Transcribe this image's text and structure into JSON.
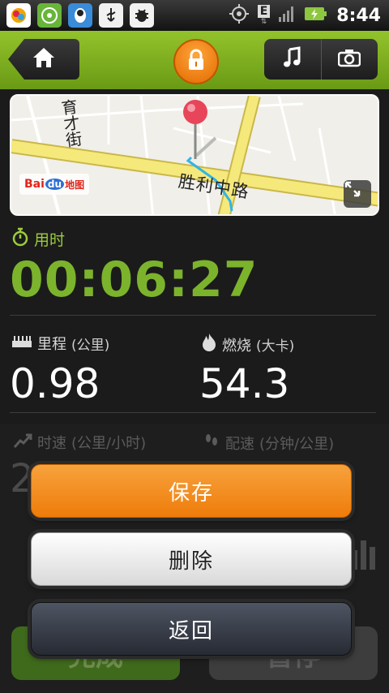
{
  "status_bar": {
    "time": "8:44",
    "network_label": "E",
    "icons": [
      "app-icon",
      "wechat-icon",
      "qq-icon",
      "usb-icon",
      "debug-bug-icon",
      "gps-icon",
      "network-e-icon",
      "signal-icon",
      "battery-icon"
    ]
  },
  "title_bar": {
    "icons": [
      "home-icon",
      "lock-icon",
      "music-icon",
      "camera-icon"
    ]
  },
  "map": {
    "street_vertical": "育才街",
    "street_main": "胜利中路",
    "logo_bai": "Bai",
    "logo_du": "du",
    "logo_map": "地图",
    "icons": [
      "location-pin-icon",
      "expand-icon"
    ]
  },
  "stats": {
    "time_label": "用时",
    "time_value": "00:06:27",
    "distance_label": "里程",
    "distance_unit": "(公里)",
    "distance_value": "0.98",
    "calories_label": "燃烧",
    "calories_unit": "(大卡)",
    "calories_value": "54.3",
    "speed_label": "时速",
    "speed_unit": "(公里/小时)",
    "speed_value_partial": "2",
    "pace_label": "配速",
    "pace_unit": "(分钟/公里)"
  },
  "bottom_buttons": {
    "finish": "完成",
    "pause": "暂停"
  },
  "dialog": {
    "save": "保存",
    "delete": "删除",
    "back": "返回"
  },
  "colors": {
    "accent_green": "#7cb32c",
    "titlebar_green": "#8ab925",
    "save_orange": "#f28c1c"
  }
}
